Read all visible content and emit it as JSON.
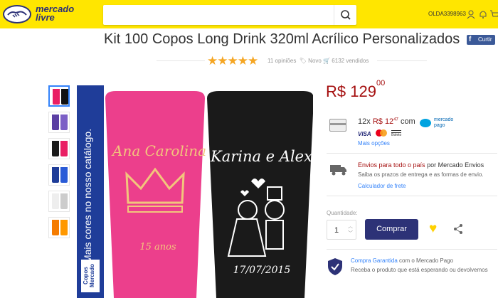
{
  "header": {
    "logo_line1": "mercado",
    "logo_line2": "livre",
    "search_value": "",
    "username": "OLDA3398963"
  },
  "product": {
    "title": "Kit 100 Copos Long Drink 320ml Acrílico Personalizados",
    "share_label": "Curtir",
    "rating": 4.5,
    "stars_text": "★★★★★",
    "reviews": "11 opiniões",
    "condition": "Novo",
    "sold": "6132 vendidos"
  },
  "image": {
    "side_text": "Mais cores no nosso catálogo.",
    "brand_text": "Copos Mercado",
    "cup1_name": "Ana Carolina",
    "cup1_sub": "15 anos",
    "cup2_name": "Karina e Alex",
    "cup2_date": "17/07/2015"
  },
  "thumbs": [
    {
      "color1": "#e91e63",
      "color2": "#111111"
    },
    {
      "color1": "#5b3fa3",
      "color2": "#7b5fc6"
    },
    {
      "color1": "#1a1a1a",
      "color2": "#e91e63"
    },
    {
      "color1": "#1f3d99",
      "color2": "#2a5bd7"
    },
    {
      "color1": "#eeeeee",
      "color2": "#cccccc"
    },
    {
      "color1": "#f57c00",
      "color2": "#ff9800"
    }
  ],
  "price": {
    "currency": "R$",
    "integer": "129",
    "cents": "00"
  },
  "installments": {
    "prefix": "12x",
    "currency": "R$",
    "integer": "12",
    "cents": "47",
    "suffix": "com",
    "mp_label1": "mercado",
    "mp_label2": "pago",
    "more_link": "Mais opções",
    "visa": "VISA",
    "boleto": "Boleto"
  },
  "shipping": {
    "main_red": "Envios para todo o país",
    "main_mid": "por",
    "main_rest": "Mercado Envios",
    "sub": "Saiba os prazos de entrega e as formas de envio.",
    "calc_link": "Calculador de frete"
  },
  "purchase": {
    "qty_label": "Quantidade:",
    "qty_value": "1",
    "buy_label": "Comprar"
  },
  "guarantee": {
    "link": "Compra Garantida",
    "rest": "com o Mercado Pago",
    "sub": "Receba o produto que está esperando ou devolvemos"
  },
  "colors": {
    "brand_yellow": "#ffe600",
    "brand_blue": "#2d3277",
    "price_red": "#a50f0f",
    "link_blue": "#3483fa",
    "star": "#f5a623"
  }
}
